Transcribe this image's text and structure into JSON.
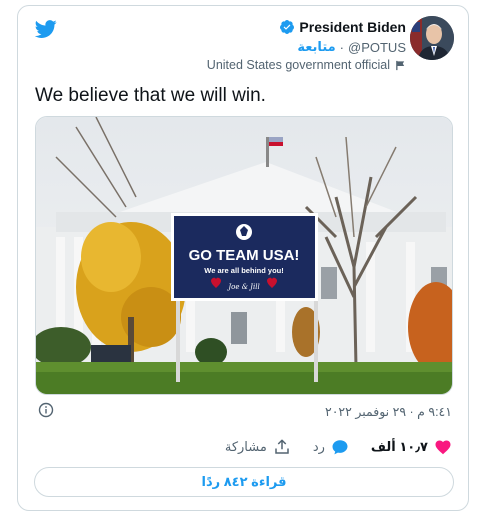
{
  "tweet": {
    "display_name": "President Biden",
    "handle": "@POTUS",
    "follow_label": "متابعة",
    "separator": "·",
    "account_label": "United States government official",
    "text": "We believe that we will win.",
    "timestamp": "٩:٤١ م · ٢٩ نوفمبر ٢٠٢٢",
    "like_count": "١٠٫٧ ألف",
    "reply_label": "رد",
    "share_label": "مشاركة",
    "read_replies_label": "قراءة ٨٤٢ ردًا"
  },
  "media": {
    "sign_title": "GO TEAM USA!",
    "sign_subtitle": "We are all behind you!",
    "sign_signature": "Joe & Jill"
  },
  "icons": {
    "logo": "twitter-bird-icon",
    "verified": "verified-badge-icon",
    "label": "flag-icon",
    "info": "info-icon",
    "like": "heart-icon",
    "reply": "reply-bubble-icon",
    "share": "share-icon"
  },
  "colors": {
    "accent": "#1d9bf0",
    "like": "#f91880",
    "text": "#0f1419",
    "muted": "#536471",
    "border": "#cfd9de",
    "sign_navy": "#1b2a5e",
    "sign_red": "#c8102e"
  }
}
